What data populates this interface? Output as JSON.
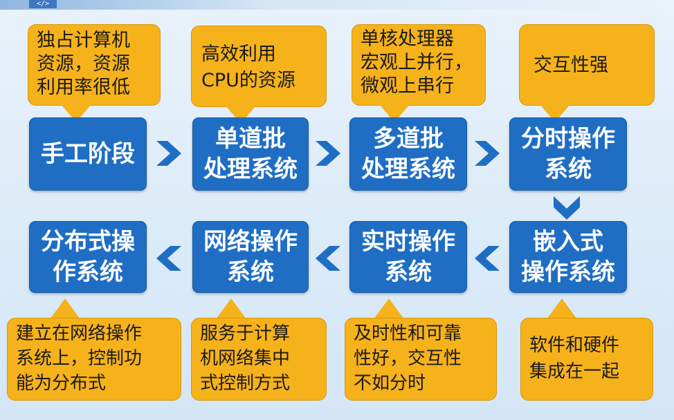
{
  "badge": "</>",
  "stages": [
    {
      "id": "manual",
      "label": "手工阶段"
    },
    {
      "id": "single-batch",
      "label": "单道批\n处理系统"
    },
    {
      "id": "multi-batch",
      "label": "多道批\n处理系统"
    },
    {
      "id": "time-sharing",
      "label": "分时操作\n系统"
    },
    {
      "id": "embedded",
      "label": "嵌入式\n操作系统"
    },
    {
      "id": "real-time",
      "label": "实时操作\n系统"
    },
    {
      "id": "network",
      "label": "网络操作\n系统"
    },
    {
      "id": "distributed",
      "label": "分布式操\n作系统"
    }
  ],
  "notes": [
    {
      "id": "manual",
      "text": "独占计算机\n资源，资源\n利用率很低"
    },
    {
      "id": "single-batch",
      "text": "高效利用\nCPU的资源"
    },
    {
      "id": "multi-batch",
      "text": "单核处理器\n宏观上并行，\n微观上串行"
    },
    {
      "id": "time-sharing",
      "text": "交互性强"
    },
    {
      "id": "embedded",
      "text": "软件和硬件\n集成在一起"
    },
    {
      "id": "real-time",
      "text": "及时性和可靠\n性好，交互性\n不如分时"
    },
    {
      "id": "network",
      "text": "服务于计算\n机网络集中\n式控制方式"
    },
    {
      "id": "distributed",
      "text": "建立在网络操作\n系统上，控制功\n能为分布式"
    }
  ],
  "colors": {
    "stage": "#1f6ec4",
    "note": "#f6b21a",
    "arrow": "#1f6ec4"
  }
}
